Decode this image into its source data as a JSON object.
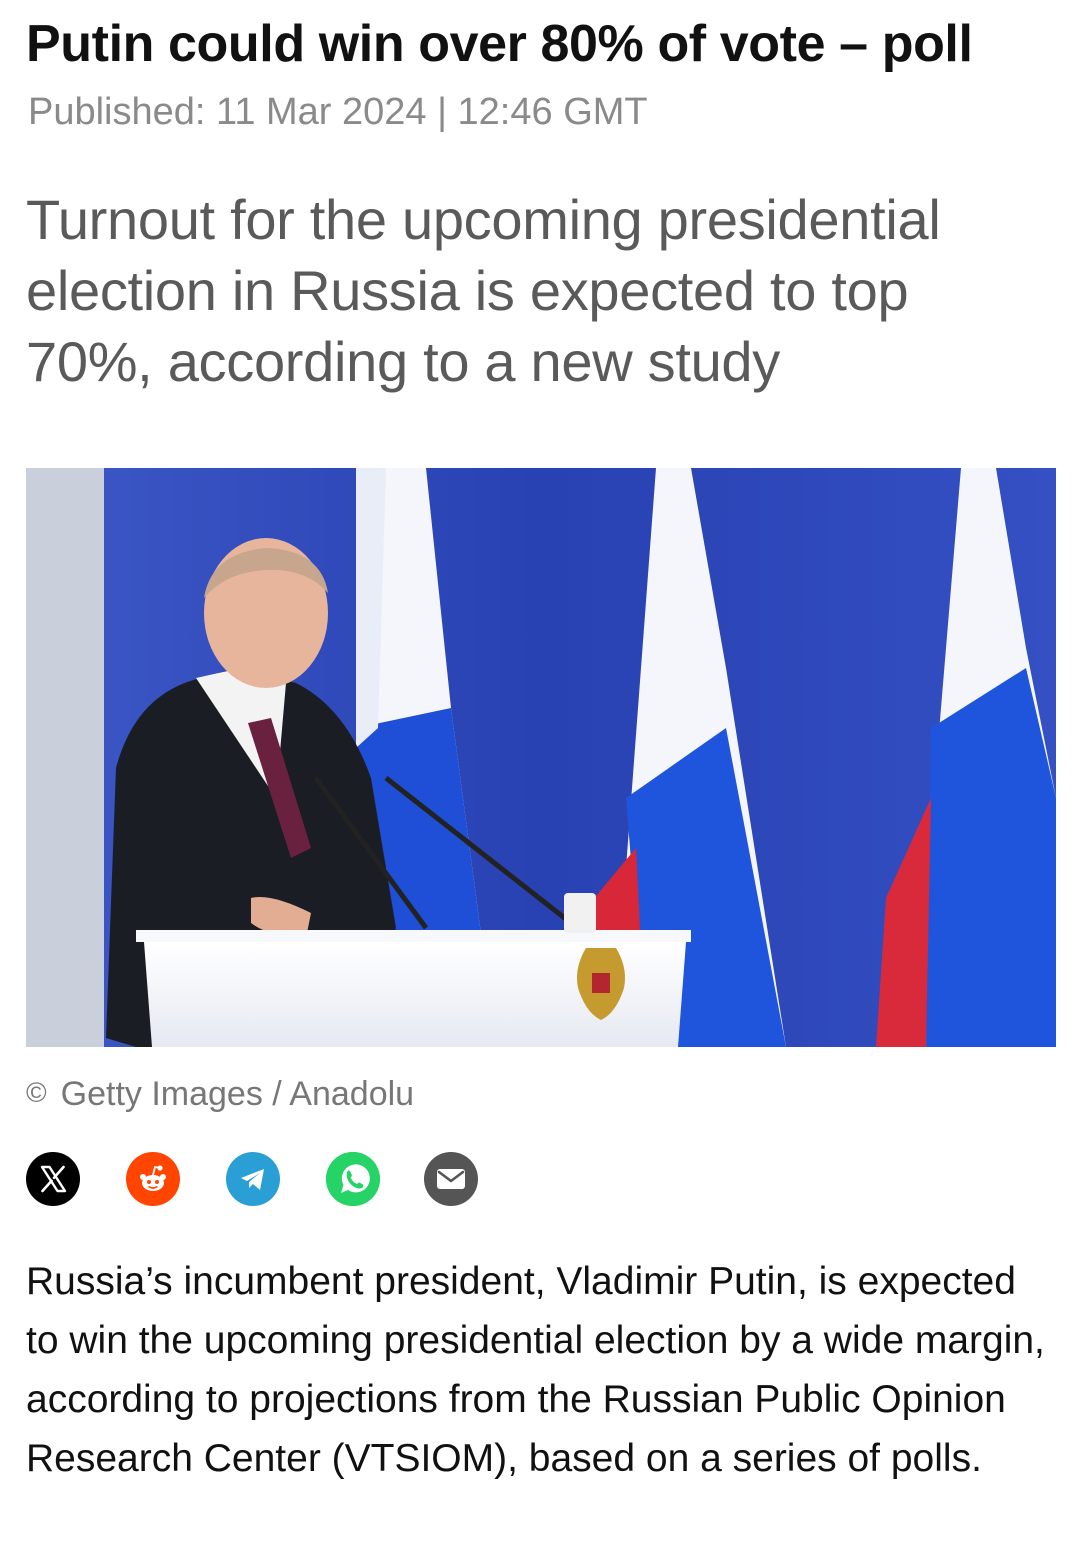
{
  "article": {
    "headline": "Putin could win over 80% of vote – poll",
    "published": "Published: 11 Mar 2024 | 12:46 GMT",
    "summary": "Turnout for the upcoming presidential election in Russia is expected to top 70%, according to a new study",
    "image": {
      "credit_symbol": "©",
      "credit": "Getty Images / Anadolu"
    },
    "share": [
      {
        "name": "x-share-button",
        "icon": "x-logo-icon",
        "color": "#000000"
      },
      {
        "name": "reddit-share-button",
        "icon": "reddit-icon",
        "color": "#ff4500"
      },
      {
        "name": "telegram-share-button",
        "icon": "telegram-icon",
        "color": "#2a9fd6"
      },
      {
        "name": "whatsapp-share-button",
        "icon": "whatsapp-icon",
        "color": "#25d366"
      },
      {
        "name": "email-share-button",
        "icon": "envelope-icon",
        "color": "#555555"
      }
    ],
    "body": "Russia’s incumbent president, Vladimir Putin, is expected to win the upcoming presidential election by a wide margin, according to projections from the Russian Public Opinion Research Center (VTSIOM), based on a series of polls."
  }
}
